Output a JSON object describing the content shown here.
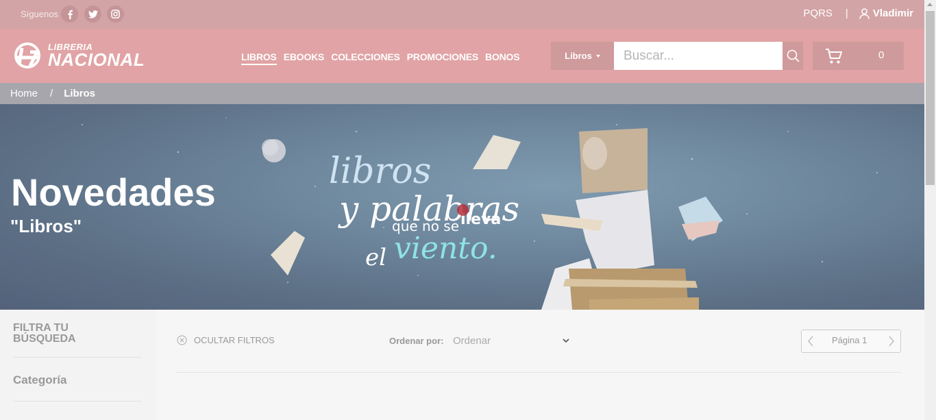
{
  "topbar": {
    "follow_label": "Síguenos",
    "social_icons": [
      "facebook-icon",
      "twitter-icon",
      "instagram-icon"
    ],
    "pqrs_label": "PQRS",
    "separator": "|",
    "user_name": "Vladimir"
  },
  "header": {
    "logo_line1": "LIBRERIA",
    "logo_line2": "NACIONAL",
    "nav": [
      {
        "label": "LIBROS",
        "active": true
      },
      {
        "label": "EBOOKS"
      },
      {
        "label": "COLECCIONES"
      },
      {
        "label": "PROMOCIONES"
      },
      {
        "label": "BONOS"
      }
    ],
    "search": {
      "category": "Libros",
      "placeholder": "Buscar..."
    },
    "cart_count": "0"
  },
  "breadcrumb": {
    "home": "Home",
    "separator": "/",
    "current": "Libros"
  },
  "hero": {
    "title": "Novedades",
    "subtitle": "\"Libros\""
  },
  "sidebar": {
    "title": "FILTRA TU BÚSQUEDA",
    "category": "Categoría"
  },
  "toolbar": {
    "hide_filters": "OCULTAR FILTROS",
    "order_label": "Ordenar por:",
    "order_value": "Ordenar",
    "page_label": "Página 1"
  },
  "colors": {
    "header": "#e1a3a5",
    "topbar": "#d3a4a6",
    "breadcrumb": "#a7a6ad"
  }
}
